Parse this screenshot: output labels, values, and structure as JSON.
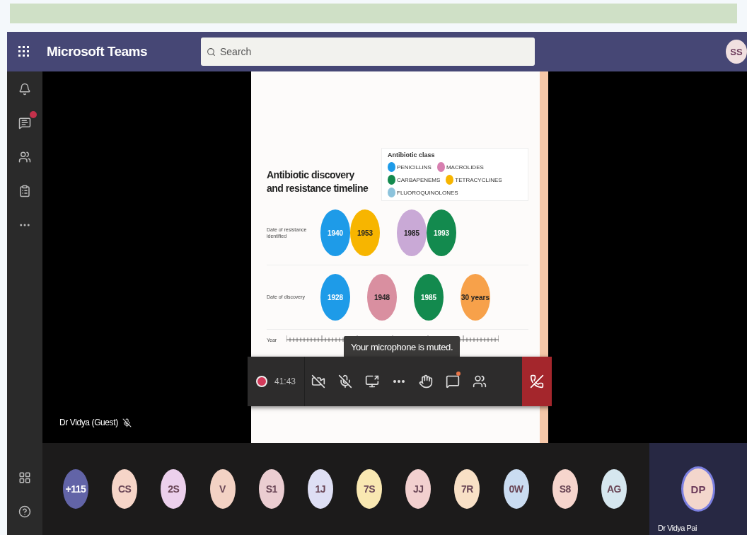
{
  "app": {
    "title": "Microsoft Teams",
    "search": {
      "placeholder": "Search"
    },
    "user": {
      "initials": "SS"
    }
  },
  "sidebar": {
    "items": [
      {
        "kind": "bell",
        "badge": false
      },
      {
        "kind": "chat",
        "badge": true
      },
      {
        "kind": "teams",
        "badge": false
      },
      {
        "kind": "assignments",
        "badge": false
      },
      {
        "kind": "more",
        "badge": false
      }
    ],
    "bottom": [
      {
        "kind": "apps"
      },
      {
        "kind": "help"
      }
    ]
  },
  "stage": {
    "presenter_name": "Dr Vidya (Guest)",
    "presenter_muted": true
  },
  "slide": {
    "title": "Antibiotic discovery and resistance timeline",
    "legend_title": "Antibiotic class",
    "legend": [
      {
        "label": "PENICILLINS",
        "color": "#1e9be8"
      },
      {
        "label": "MACROLIDES",
        "color": "#d77fb0"
      },
      {
        "label": "CARBAPENEMS",
        "color": "#138a4e"
      },
      {
        "label": "TETRACYCLINES",
        "color": "#f7b500"
      },
      {
        "label": "FLUOROQUINOLONES",
        "color": "#8cc3dc"
      }
    ],
    "rows": [
      {
        "label": "Date of resistance identified",
        "groups": [
          [
            {
              "text": "1940",
              "color": "#1e9be8"
            },
            {
              "text": "1953",
              "color": "#f7b500"
            }
          ],
          [
            {
              "text": "1985",
              "color": "#c9a9d6"
            },
            {
              "text": "1993",
              "color": "#138a4e"
            }
          ]
        ]
      },
      {
        "label": "Date of discovery",
        "groups": [
          [
            {
              "text": "1928",
              "color": "#1e9be8"
            }
          ],
          [
            {
              "text": "1948",
              "color": "#d98fa0"
            }
          ],
          [
            {
              "text": "1985",
              "color": "#138a4e"
            }
          ],
          [
            {
              "text": "30 years",
              "color": "#f7a14a"
            }
          ]
        ]
      }
    ],
    "axis_label": "Year"
  },
  "call": {
    "recording": true,
    "timer": "41:43",
    "tooltip": "Your microphone is muted.",
    "camera_on": false,
    "mic_on": false,
    "chat_unread": true
  },
  "participants": [
    {
      "initials": "+115",
      "color": "#6264a7"
    },
    {
      "initials": "CS",
      "color": "#f6d5c8"
    },
    {
      "initials": "2S",
      "color": "#ecd0ec"
    },
    {
      "initials": "V",
      "color": "#f3d2c4"
    },
    {
      "initials": "S1",
      "color": "#ebcdd1"
    },
    {
      "initials": "1J",
      "color": "#dedff4"
    },
    {
      "initials": "7S",
      "color": "#f9e8b2"
    },
    {
      "initials": "JJ",
      "color": "#f2d0cf"
    },
    {
      "initials": "7R",
      "color": "#f8e0c6"
    },
    {
      "initials": "0W",
      "color": "#cadcf1"
    },
    {
      "initials": "S8",
      "color": "#f6d5cd"
    },
    {
      "initials": "AG",
      "color": "#d6e7ef"
    }
  ],
  "speaker": {
    "initials": "DP",
    "name": "Dr Vidya Pai",
    "speaking": true
  }
}
